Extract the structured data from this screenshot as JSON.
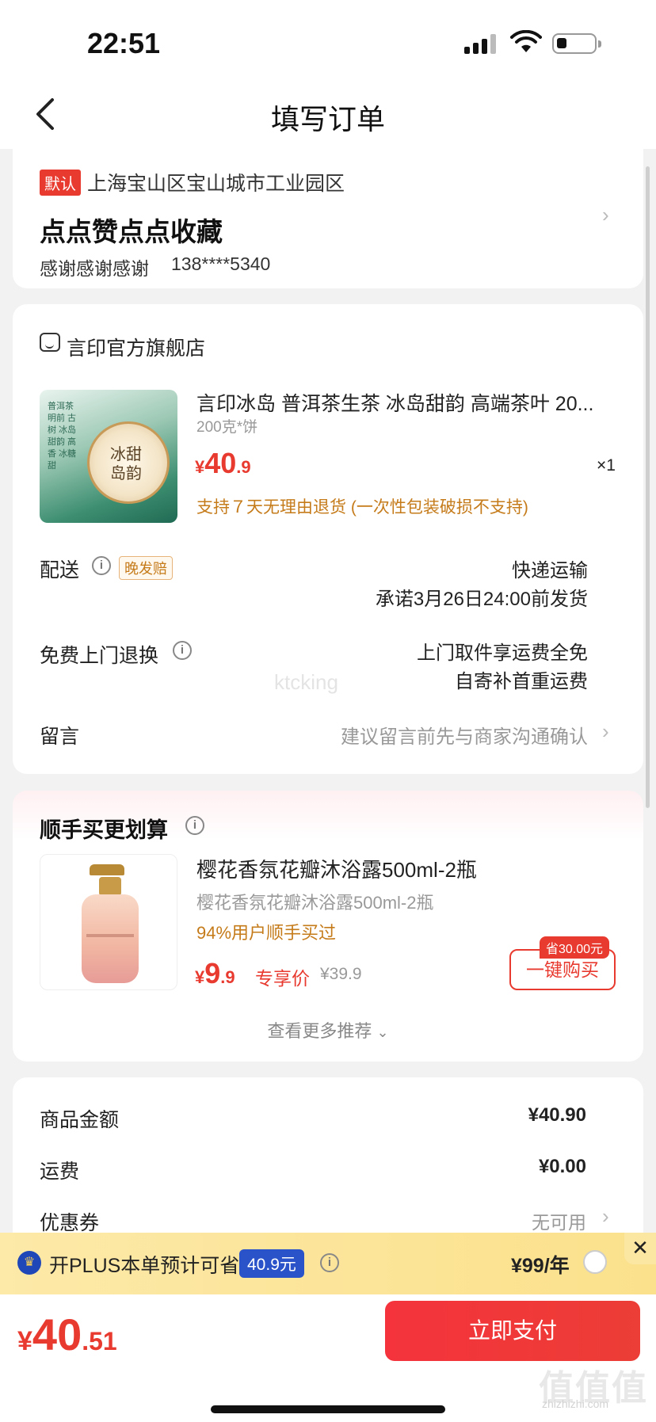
{
  "status_bar": {
    "time": "22:51"
  },
  "nav": {
    "title": "填写订单"
  },
  "address": {
    "tag": "默认",
    "region": "上海宝山区宝山城市工业园区",
    "detail": "点点赞点点收藏",
    "name": "感谢感谢感谢",
    "phone": "138****5340"
  },
  "store": {
    "name": "言印官方旗舰店",
    "product": {
      "title": "言印冰岛 普洱茶生茶 冰岛甜韵 高端茶叶 20...",
      "spec": "200克*饼",
      "price_yen": "¥",
      "price_int": "40",
      "price_dec": ".9",
      "qty": "×1",
      "return_note": "支持７天无理由退货 (一次性包装破损不支持)",
      "image_text": "冰甜岛韵",
      "image_label": "普洱茶 明前 古树 冰岛甜韵 高香 冰糖甜"
    },
    "delivery": {
      "label": "配送",
      "tag": "晚发赔",
      "method": "快递运输",
      "promise": "承诺3月26日24:00前发货"
    },
    "return_service": {
      "label": "免费上门退换",
      "line1": "上门取件享运费全免",
      "line2": "自寄补首重运费"
    },
    "remark": {
      "label": "留言",
      "placeholder": "建议留言前先与商家沟通确认"
    },
    "watermark": "ktcking"
  },
  "recommend": {
    "title": "顺手买更划算",
    "item": {
      "name": "樱花香氛花瓣沐浴露500ml-2瓶",
      "sub": "樱花香氛花瓣沐浴露500ml-2瓶",
      "stat": "94%用户顺手买过",
      "price_yen": "¥",
      "price_int": "9",
      "price_dec": ".9",
      "price_label": "专享价",
      "original_price": "¥39.9",
      "save_badge": "省30.00元",
      "buy_button": "一键购买"
    },
    "more": "查看更多推荐"
  },
  "summary": {
    "goods_label": "商品金额",
    "goods_value": "¥40.90",
    "shipping_label": "运费",
    "shipping_value": "¥0.00",
    "coupon_label": "优惠券",
    "coupon_value": "无可用"
  },
  "plus": {
    "text": "开PLUS本单预计可省",
    "amount": "40.9元",
    "price": "¥99/年",
    "close": "✕"
  },
  "bottom": {
    "total_yen": "¥",
    "total_int": "40",
    "total_dec": ".51",
    "pay_button": "立即支付",
    "site_mark": "值值值",
    "site_url": "zhizhizhi.com"
  },
  "colors": {
    "accent": "#e83a2f",
    "orange_note": "#c57b1a",
    "plus_blue": "#2a53c9",
    "plus_bg": "#fbe18c"
  }
}
